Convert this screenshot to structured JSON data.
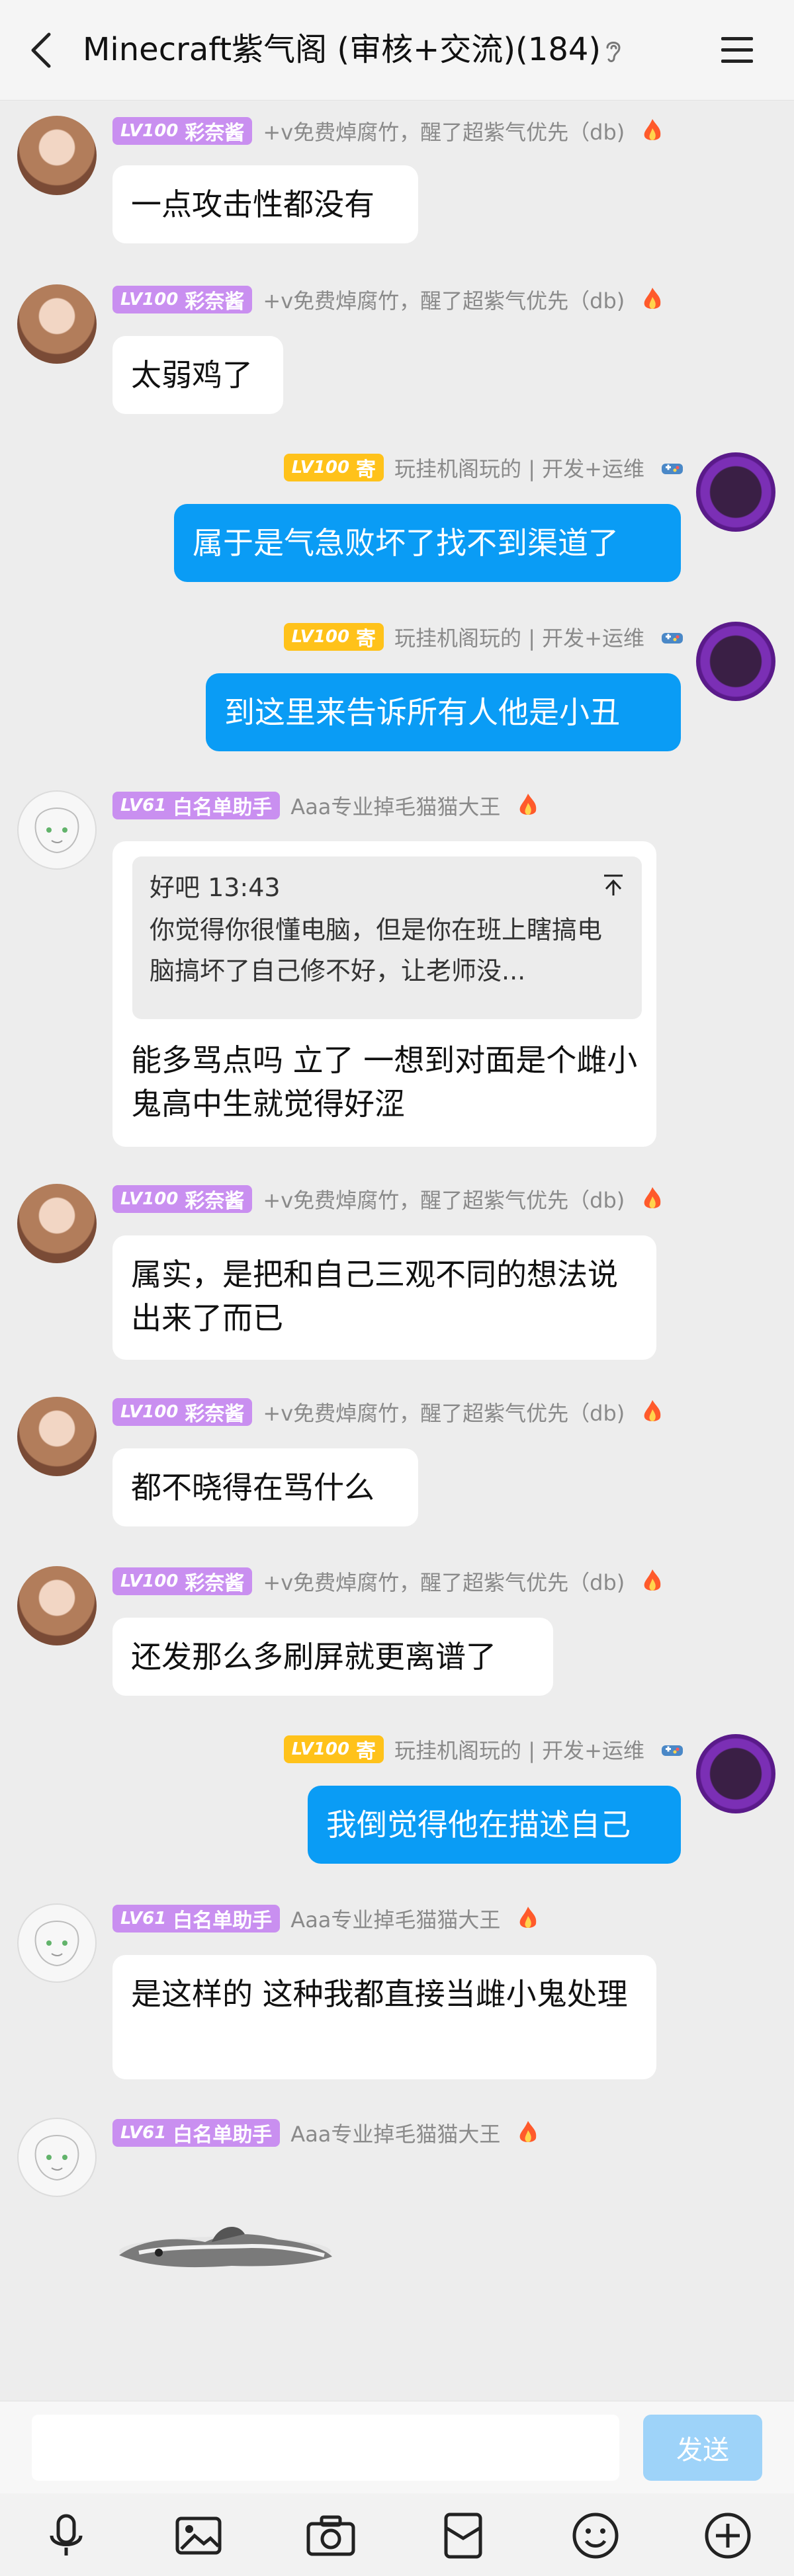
{
  "header": {
    "title": "Minecraft紫气阁 (审核+交流)(184)"
  },
  "users": {
    "sayo": {
      "level": "LV100",
      "title": "彩奈酱",
      "nick": "+v免费焯腐竹，醒了超紫气优先（db)"
    },
    "robot": {
      "level": "LV100",
      "title": "寄",
      "nick": "玩挂机阁玩的 | 开发+运维"
    },
    "sketch": {
      "level": "LV61",
      "title": "白名单助手",
      "nick": "Aaa专业掉毛猫猫大王"
    }
  },
  "messages": [
    {
      "text": "一点攻击性都没有"
    },
    {
      "text": "太弱鸡了"
    },
    {
      "text": "属于是气急败坏了找不到渠道了"
    },
    {
      "text": "到这里来告诉所有人他是小丑"
    },
    {
      "quote": {
        "title": "好吧 13:43",
        "text": "你觉得你很懂电脑，但是你在班上瞎搞电脑搞坏了自己修不好，让老师没..."
      },
      "text": "能多骂点吗 立了 一想到对面是个雌小鬼高中生就觉得好涩"
    },
    {
      "text": "属实，是把和自己三观不同的想法说出来了而已"
    },
    {
      "text": "都不晓得在骂什么"
    },
    {
      "text": "还发那么多刷屏就更离谱了"
    },
    {
      "text": "我倒觉得他在描述自己"
    },
    {
      "text": "是这样的 这种我都直接当雌小鬼处理"
    }
  ],
  "input": {
    "placeholder": "",
    "send_label": "发送"
  },
  "toolbar": [
    "mic-icon",
    "image-icon",
    "camera-icon",
    "red-packet-icon",
    "emoji-icon",
    "plus-icon"
  ],
  "colors": {
    "bubble_self": "#0a9cf5",
    "badge_purple": "#c98ff0",
    "badge_yellow": "#ffc21a",
    "send_disabled": "#9ed3f9"
  }
}
